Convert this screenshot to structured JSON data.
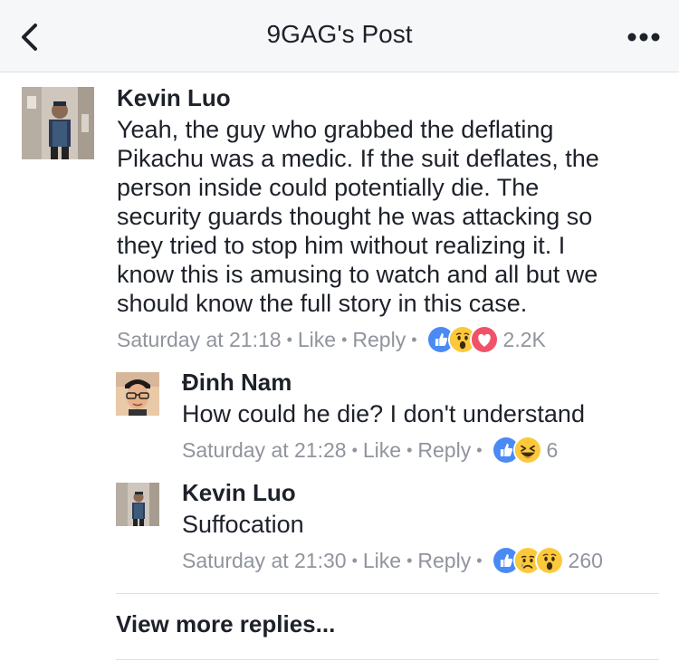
{
  "header": {
    "title": "9GAG's Post"
  },
  "comment": {
    "author": "Kevin Luo",
    "lines": [
      "Yeah, the guy who grabbed the deflating",
      "Pikachu was a medic. If the suit deflates, the",
      "person inside could potentially die. The",
      "security guards thought he was attacking so",
      "they tried to stop him without realizing it. I",
      "know this is amusing to watch and all but we",
      "should know the full story in this case."
    ],
    "timestamp": "Saturday at 21:18",
    "like_label": "Like",
    "reply_label": "Reply",
    "reactions": [
      "like-icon",
      "wow-icon",
      "love-icon"
    ],
    "reaction_count": "2.2K"
  },
  "replies": [
    {
      "author": "Đinh Nam",
      "text": "How could he die? I don't  understand",
      "timestamp": "Saturday at 21:28",
      "like_label": "Like",
      "reply_label": "Reply",
      "reactions": [
        "like-icon",
        "haha-icon"
      ],
      "reaction_count": "6"
    },
    {
      "author": "Kevin Luo",
      "text": "Suffocation",
      "timestamp": "Saturday at 21:30",
      "like_label": "Like",
      "reply_label": "Reply",
      "reactions": [
        "like-icon",
        "sad-icon",
        "wow-icon"
      ],
      "reaction_count": "260"
    }
  ],
  "view_more_label": "View more replies...",
  "colors": {
    "like": "#4a8af4",
    "love": "#f25268",
    "emoji_yellow": "#fcc93a",
    "meta_gray": "#90949c",
    "header_bg": "#f6f7f9"
  }
}
